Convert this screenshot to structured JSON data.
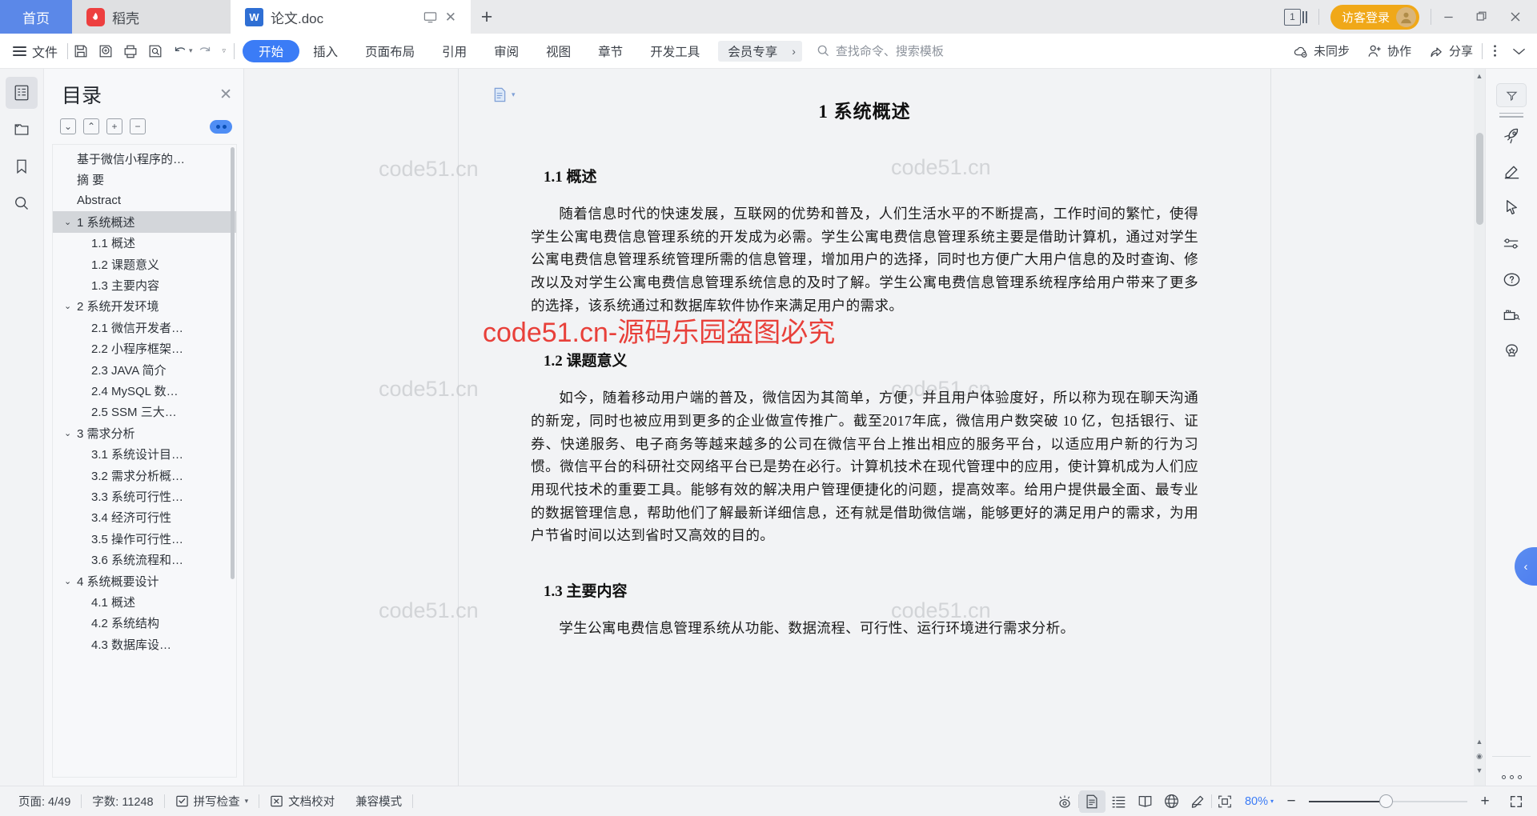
{
  "tabs": [
    {
      "label": "首页",
      "icon": "home-tab",
      "type": "home"
    },
    {
      "label": "稻壳",
      "icon": "docer-icon",
      "type": "docer"
    },
    {
      "label": "论文.doc",
      "icon": "wps-writer-icon",
      "type": "doc",
      "active": true
    }
  ],
  "titlebar": {
    "new_tab_label": "+",
    "page_count": "1",
    "login_label": "访客登录",
    "minimize": "minimize-icon",
    "maximize": "restore-icon",
    "close": "close-icon"
  },
  "ribbon": {
    "file_label": "文件",
    "quick_tools": [
      "save-icon",
      "save-as-cloud-icon",
      "print-icon",
      "print-preview-icon",
      "undo-icon",
      "redo-icon"
    ],
    "tabs": [
      {
        "label": "开始",
        "active": true
      },
      {
        "label": "插入",
        "active": false
      },
      {
        "label": "页面布局",
        "active": false
      },
      {
        "label": "引用",
        "active": false
      },
      {
        "label": "审阅",
        "active": false
      },
      {
        "label": "视图",
        "active": false
      },
      {
        "label": "章节",
        "active": false
      },
      {
        "label": "开发工具",
        "active": false
      }
    ],
    "vip_label": "会员专享",
    "search_placeholder": "查找命令、搜索模板",
    "sync_label": "未同步",
    "collab_label": "协作",
    "share_label": "分享"
  },
  "rail": {
    "items": [
      {
        "name": "toc-icon",
        "active": true
      },
      {
        "name": "thumbnail-icon",
        "active": false
      },
      {
        "name": "bookmark-icon",
        "active": false
      },
      {
        "name": "search-icon",
        "active": false
      }
    ]
  },
  "toc": {
    "title": "目录",
    "close": "close-icon",
    "tools": [
      "expand-down-icon",
      "collapse-up-icon",
      "expand-all-icon",
      "collapse-all-icon"
    ],
    "items": [
      {
        "label": "基于微信小程序的…",
        "level": 0,
        "chev": "",
        "selected": false
      },
      {
        "label": "摘  要",
        "level": 0,
        "chev": "",
        "selected": false
      },
      {
        "label": "Abstract",
        "level": 0,
        "chev": "",
        "selected": false
      },
      {
        "label": "1  系统概述",
        "level": 1,
        "chev": "v",
        "selected": true
      },
      {
        "label": "1.1  概述",
        "level": 2,
        "chev": "",
        "selected": false
      },
      {
        "label": "1.2 课题意义",
        "level": 2,
        "chev": "",
        "selected": false
      },
      {
        "label": "1.3  主要内容",
        "level": 2,
        "chev": "",
        "selected": false
      },
      {
        "label": "2  系统开发环境",
        "level": 1,
        "chev": "v",
        "selected": false
      },
      {
        "label": "2.1 微信开发者…",
        "level": 2,
        "chev": "",
        "selected": false
      },
      {
        "label": "2.2 小程序框架…",
        "level": 2,
        "chev": "",
        "selected": false
      },
      {
        "label": "2.3 JAVA 简介",
        "level": 2,
        "chev": "",
        "selected": false
      },
      {
        "label": "2.4 MySQL 数…",
        "level": 2,
        "chev": "",
        "selected": false
      },
      {
        "label": "2.5 SSM 三大…",
        "level": 2,
        "chev": "",
        "selected": false
      },
      {
        "label": "3  需求分析",
        "level": 1,
        "chev": "v",
        "selected": false
      },
      {
        "label": "3.1  系统设计目…",
        "level": 2,
        "chev": "",
        "selected": false
      },
      {
        "label": "3.2 需求分析概…",
        "level": 2,
        "chev": "",
        "selected": false
      },
      {
        "label": "3.3  系统可行性…",
        "level": 2,
        "chev": "",
        "selected": false
      },
      {
        "label": "3.4 经济可行性",
        "level": 2,
        "chev": "",
        "selected": false
      },
      {
        "label": "3.5 操作可行性…",
        "level": 2,
        "chev": "",
        "selected": false
      },
      {
        "label": "3.6 系统流程和…",
        "level": 2,
        "chev": "",
        "selected": false
      },
      {
        "label": "4 系统概要设计",
        "level": 1,
        "chev": "v",
        "selected": false
      },
      {
        "label": "4.1  概述",
        "level": 2,
        "chev": "",
        "selected": false
      },
      {
        "label": "4.2  系统结构",
        "level": 2,
        "chev": "",
        "selected": false
      },
      {
        "label": "4.3  数据库设…",
        "level": 2,
        "chev": "",
        "selected": false
      }
    ]
  },
  "document": {
    "section_mark": "section-break-icon",
    "heading1": "1  系统概述",
    "heading_1_1": "1.1  概述",
    "para_1_1": "随着信息时代的快速发展，互联网的优势和普及，人们生活水平的不断提高，工作时间的繁忙，使得学生公寓电费信息管理系统的开发成为必需。学生公寓电费信息管理系统主要是借助计算机，通过对学生公寓电费信息管理系统管理所需的信息管理，增加用户的选择，同时也方便广大用户信息的及时查询、修改以及对学生公寓电费信息管理系统信息的及时了解。学生公寓电费信息管理系统程序给用户带来了更多的选择，该系统通过和数据库软件协作来满足用户的需求。",
    "heading_1_2": "1.2 课题意义",
    "para_1_2": "如今，随着移动用户端的普及，微信因为其简单，方便，并且用户体验度好，所以称为现在聊天沟通的新宠，同时也被应用到更多的企业做宣传推广。截至2017年底，微信用户数突破 10 亿，包括银行、证券、快递服务、电子商务等越来越多的公司在微信平台上推出相应的服务平台，以适应用户新的行为习惯。微信平台的科研社交网络平台已是势在必行。计算机技术在现代管理中的应用，使计算机成为人们应用现代技术的重要工具。能够有效的解决用户管理便捷化的问题，提高效率。给用户提供最全面、最专业的数据管理信息，帮助他们了解最新详细信息，还有就是借助微信端，能够更好的满足用户的需求，为用户节省时间以达到省时又高效的目的。",
    "heading_1_3": "1.3  主要内容",
    "para_1_3": "学生公寓电费信息管理系统从功能、数据流程、可行性、运行环境进行需求分析。",
    "watermark_text": "code51.cn",
    "watermark_red": "code51.cn-源码乐园盗图必究"
  },
  "right_rail": {
    "items": [
      {
        "name": "rocket-icon"
      },
      {
        "name": "brush-icon"
      },
      {
        "name": "cursor-icon"
      },
      {
        "name": "sliders-icon"
      },
      {
        "name": "help-icon"
      },
      {
        "name": "ocr-icon"
      },
      {
        "name": "ai-brain-icon"
      }
    ],
    "collapse": "collapse-left-icon",
    "more": "more-dots-icon",
    "float_button": "filter-down-icon"
  },
  "status": {
    "page_label": "页面: 4/49",
    "word_count_label": "字数: 11248",
    "spellcheck_label": "拼写检查",
    "proofread_label": "文档校对",
    "compat_label": "兼容模式",
    "view_buttons": [
      {
        "name": "eye-icon",
        "active": false
      },
      {
        "name": "page-view-icon",
        "active": true
      },
      {
        "name": "outline-view-icon",
        "active": false
      },
      {
        "name": "reading-view-icon",
        "active": false
      },
      {
        "name": "web-view-icon",
        "active": false
      },
      {
        "name": "annotate-icon",
        "active": false
      }
    ],
    "fit_icon": "fit-page-icon",
    "zoom_value": "80%",
    "zoom_out": "−",
    "zoom_in": "+",
    "fullscreen": "fullscreen-icon"
  },
  "colors": {
    "accent": "#3b7cf6",
    "home_tab": "#5b88e8",
    "login": "#f0a818",
    "watermark_red": "#e8403a",
    "docer_red": "#ed3f3f"
  }
}
